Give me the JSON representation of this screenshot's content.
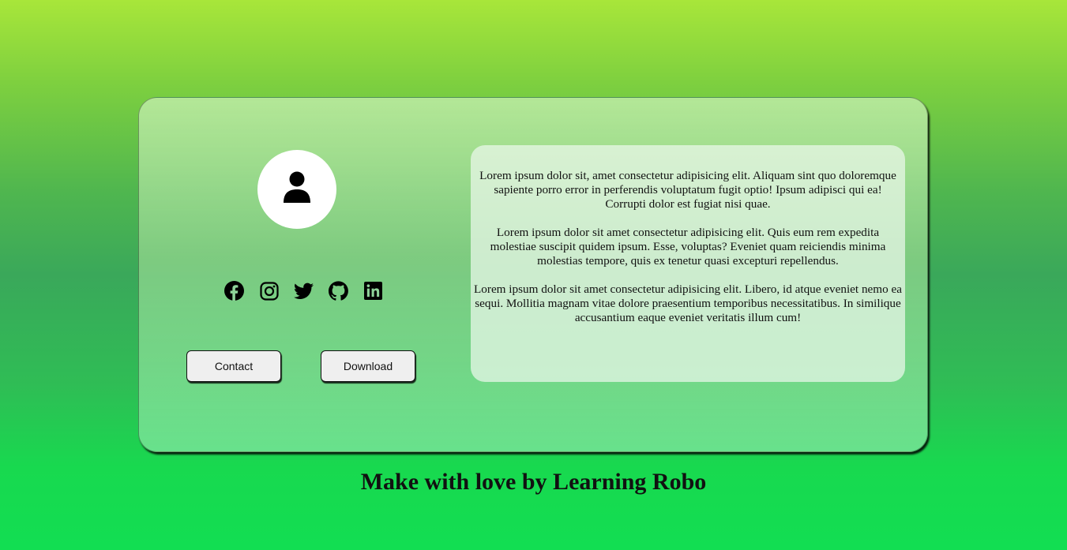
{
  "profile": {
    "avatar_icon": "user-icon"
  },
  "social": [
    {
      "name": "facebook-icon"
    },
    {
      "name": "instagram-icon"
    },
    {
      "name": "twitter-icon"
    },
    {
      "name": "github-icon"
    },
    {
      "name": "linkedin-icon"
    }
  ],
  "buttons": {
    "contact_label": "Contact",
    "download_label": "Download"
  },
  "about": {
    "paragraphs": [
      "Lorem ipsum dolor sit, amet consectetur adipisicing elit. Aliquam sint quo doloremque sapiente porro error in perferendis voluptatum fugit optio! Ipsum adipisci qui ea! Corrupti dolor est fugiat nisi quae.",
      "Lorem ipsum dolor sit amet consectetur adipisicing elit. Quis eum rem expedita molestiae suscipit quidem ipsum. Esse, voluptas? Eveniet quam reiciendis minima molestias tempore, quis ex tenetur quasi excepturi repellendus.",
      "Lorem ipsum dolor sit amet consectetur adipisicing elit. Libero, id atque eveniet nemo ea sequi. Mollitia magnam vitae dolore praesentium temporibus necessitatibus. In similique accusantium eaque eveniet veritatis illum cum!"
    ]
  },
  "footer": {
    "text": "Make with love by Learning Robo"
  },
  "colors": {
    "background_top": "#a8e63a",
    "background_bottom": "#12de52",
    "button_bg": "#efefef"
  }
}
